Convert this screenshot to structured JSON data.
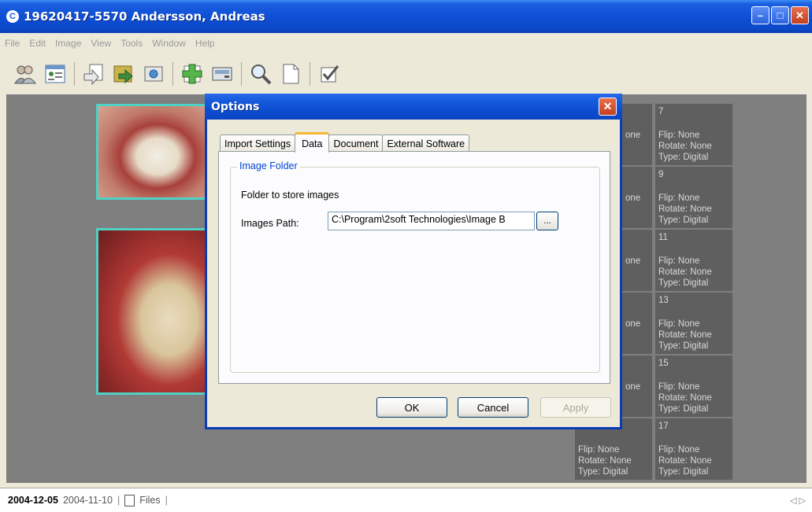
{
  "window": {
    "title": "19620417-5570 Andersson, Andreas"
  },
  "menu": [
    "File",
    "Edit",
    "Image",
    "View",
    "Tools",
    "Window",
    "Help"
  ],
  "toolbar_icons": [
    "patients-icon",
    "patient-card-icon",
    "import-icon",
    "export-icon",
    "camera-icon",
    "add-image-icon",
    "scanner-icon",
    "zoom-icon",
    "new-document-icon",
    "checklist-icon"
  ],
  "thumbnails": [
    {
      "num": "7",
      "flip": "Flip: None",
      "rotate": "Rotate: None",
      "type": "Type: Digital"
    },
    {
      "num": "9",
      "flip": "Flip: None",
      "rotate": "Rotate: None",
      "type": "Type: Digital"
    },
    {
      "num": "11",
      "flip": "Flip: None",
      "rotate": "Rotate: None",
      "type": "Type: Digital"
    },
    {
      "num": "13",
      "flip": "Flip: None",
      "rotate": "Rotate: None",
      "type": "Type: Digital"
    },
    {
      "num": "15",
      "flip": "Flip: None",
      "rotate": "Rotate: None",
      "type": "Type: Digital"
    },
    {
      "num": "17",
      "flip": "Flip: None",
      "rotate": "Rotate: None",
      "type": "Type: Digital"
    }
  ],
  "left_thumbnails": [
    {
      "text": "one"
    },
    {
      "text": "one"
    },
    {
      "text": "one"
    },
    {
      "text": "one"
    },
    {
      "text": "one"
    },
    {
      "flip": "Flip: None",
      "rotate": "Rotate: None",
      "type": "Type: Digital"
    }
  ],
  "bottom_tabs": {
    "active": "2004-12-05",
    "second": "2004-11-10",
    "files": "Files"
  },
  "dialog": {
    "title": "Options",
    "tabs": [
      "Import Settings",
      "Data",
      "Document",
      "External Software"
    ],
    "active_tab": "Data",
    "group_title": "Image Folder",
    "folder_label": "Folder to store images",
    "path_label": "Images Path:",
    "path_value": "C:\\Program\\2soft Technologies\\Image B",
    "browse_label": "...",
    "ok_label": "OK",
    "cancel_label": "Cancel",
    "apply_label": "Apply"
  }
}
